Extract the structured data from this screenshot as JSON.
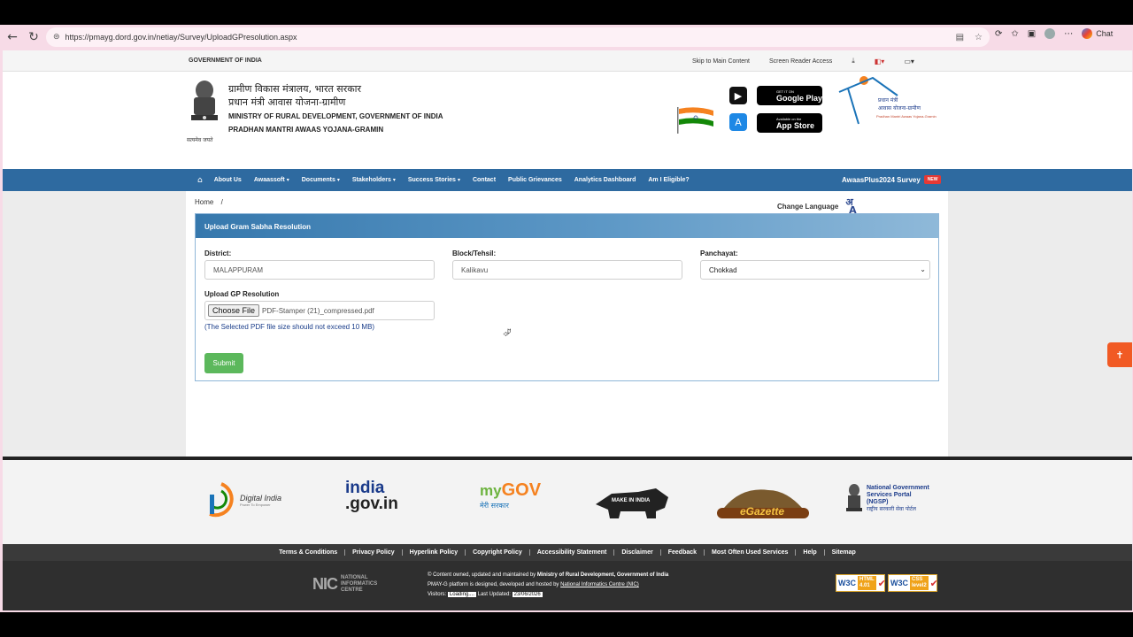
{
  "browser": {
    "url": "https://pmayg.dord.gov.in/netiay/Survey/UploadGPresolution.aspx",
    "chat_label": "Chat"
  },
  "topstrip": {
    "goi": "GOVERNMENT OF INDIA",
    "skip": "Skip to Main Content",
    "reader": "Screen Reader Access"
  },
  "header": {
    "hindi_line1": "ग्रामीण विकास मंत्रालय, भारत सरकार",
    "hindi_line2": "प्रधान मंत्री आवास योजना-ग्रामीण",
    "english_line1": "MINISTRY OF RURAL DEVELOPMENT, GOVERNMENT OF INDIA",
    "english_line2": "PRADHAN MANTRI AWAAS YOJANA-GRAMIN",
    "emblem_caption": "सत्यमेव जयते",
    "google_play_small": "GET IT ON",
    "google_play": "Google Play",
    "app_store_small": "Available on the",
    "app_store": "App Store",
    "pmay_hindi1": "प्रधान मंत्री",
    "pmay_hindi2": "आवास योजना-ग्रामीण",
    "pmay_eng": "Pradhan Mantri Awaas Yojana-Gramin"
  },
  "nav": {
    "items": [
      {
        "label": "About Us",
        "dropdown": false
      },
      {
        "label": "Awaassoft",
        "dropdown": true
      },
      {
        "label": "Documents",
        "dropdown": true
      },
      {
        "label": "Stakeholders",
        "dropdown": true
      },
      {
        "label": "Success Stories",
        "dropdown": true
      },
      {
        "label": "Contact",
        "dropdown": false
      },
      {
        "label": "Public Grievances",
        "dropdown": false
      },
      {
        "label": "Analytics Dashboard",
        "dropdown": false
      },
      {
        "label": "Am I Eligible?",
        "dropdown": false
      }
    ],
    "survey": "AwaasPlus2024 Survey",
    "new_badge": "NEW"
  },
  "breadcrumb": {
    "home": "Home",
    "sep": "/"
  },
  "change_language": "Change Language",
  "form": {
    "title": "Upload Gram Sabha Resolution",
    "district_label": "District:",
    "district_value": "MALAPPURAM",
    "block_label": "Block/Tehsil:",
    "block_value": "Kalikavu",
    "panchayat_label": "Panchayat:",
    "panchayat_value": "Chokkad",
    "upload_label": "Upload GP Resolution",
    "choose_file": "Choose File",
    "file_name": "PDF-Stamper (21)_compressed.pdf",
    "hint": "(The Selected PDF file size should not exceed 10 MB)",
    "submit": "Submit"
  },
  "footer_logos": {
    "digital_india": "Digital India",
    "digital_india_tag": "Power To Empower",
    "india_gov_1": "india",
    "india_gov_2": ".gov.in",
    "mygov_1": "my",
    "mygov_2": "GOV",
    "mygov_3": "मेरी सरकार",
    "make_in_india": "MAKE IN INDIA",
    "egazette": "eGazette",
    "ngsp_1": "National Government",
    "ngsp_2": "Services Portal",
    "ngsp_3": "(NGSP)",
    "ngsp_4": "राष्ट्रीय सरकारी सेवा पोर्टल"
  },
  "footer_links": [
    "Terms & Conditions",
    "Privacy Policy",
    "Hyperlink Policy",
    "Copyright Policy",
    "Accessibility Statement",
    "Disclaimer",
    "Feedback",
    "Most Often Used Services",
    "Help",
    "Sitemap"
  ],
  "footer_bottom": {
    "nic_big": "NIC",
    "nic_small_1": "NATIONAL",
    "nic_small_2": "INFORMATICS",
    "nic_small_3": "CENTRE",
    "line1_prefix": "© Content owned, updated and maintained by ",
    "line1_bold": "Ministry of Rural Development, Government of India",
    "line2_prefix": "PMAY-G platform is designed, developed and hosted by ",
    "line2_link": "National Informatics Centre (NIC)",
    "visitors_label": "Visitors:",
    "visitors_value": "Loading....",
    "updated_label": "Last Updated:",
    "updated_value": "23/06/2026",
    "w3c_html": "HTML 4.01",
    "w3c_css": "CSS level2"
  }
}
